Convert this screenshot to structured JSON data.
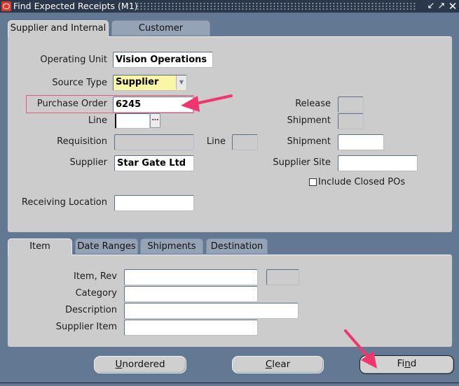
{
  "window": {
    "title": "Find Expected Receipts (M1)",
    "controls": {
      "minimize": "↙",
      "maximize": "↗",
      "close": "✕"
    }
  },
  "top_tabs": [
    {
      "label": "Supplier and Internal",
      "active": true
    },
    {
      "label": "Customer",
      "active": false
    }
  ],
  "form": {
    "operating_unit": {
      "label": "Operating Unit",
      "value": "Vision Operations"
    },
    "source_type": {
      "label": "Source Type",
      "value": "Supplier"
    },
    "purchase_order": {
      "label": "Purchase Order",
      "value": "6245"
    },
    "po_line": {
      "label": "Line",
      "value": ""
    },
    "release": {
      "label": "Release",
      "value": ""
    },
    "shipment_po": {
      "label": "Shipment",
      "value": ""
    },
    "requisition": {
      "label": "Requisition",
      "value": ""
    },
    "req_line": {
      "label": "Line",
      "value": ""
    },
    "shipment_req": {
      "label": "Shipment",
      "value": ""
    },
    "supplier": {
      "label": "Supplier",
      "value": "Star Gate Ltd"
    },
    "supplier_site": {
      "label": "Supplier Site",
      "value": ""
    },
    "include_closed": {
      "label": "Include Closed POs",
      "checked": false
    },
    "receiving_location": {
      "label": "Receiving Location",
      "value": ""
    }
  },
  "bottom_tabs": [
    {
      "label": "Item",
      "active": true
    },
    {
      "label": "Date Ranges",
      "active": false
    },
    {
      "label": "Shipments",
      "active": false
    },
    {
      "label": "Destination",
      "active": false
    }
  ],
  "item_tab": {
    "item_rev": {
      "label": "Item, Rev",
      "value": "",
      "rev": ""
    },
    "category": {
      "label": "Category",
      "value": ""
    },
    "description": {
      "label": "Description",
      "value": ""
    },
    "supplier_item": {
      "label": "Supplier Item",
      "value": ""
    }
  },
  "buttons": {
    "unordered": {
      "mnemonic": "U",
      "rest": "nordered"
    },
    "clear": {
      "mnemonic": "C",
      "rest": "lear"
    },
    "find": {
      "pre": "Fi",
      "mnemonic": "n",
      "rest": "d"
    }
  },
  "annotations": {
    "arrow_color": "#f0366e",
    "highlight_color": "#e8557a"
  }
}
